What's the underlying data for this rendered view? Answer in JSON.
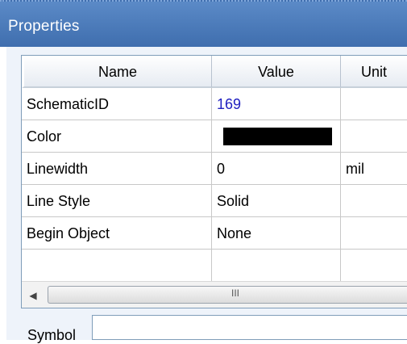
{
  "window": {
    "title": "Properties"
  },
  "grid": {
    "columns": [
      "Name",
      "Value",
      "Unit"
    ],
    "rows": [
      {
        "name": "SchematicID",
        "value": "169",
        "unit": ""
      },
      {
        "name": "Color",
        "value": "",
        "unit": "",
        "swatch": "#000000"
      },
      {
        "name": "Linewidth",
        "value": "0",
        "unit": "mil"
      },
      {
        "name": "Line Style",
        "value": "Solid",
        "unit": ""
      },
      {
        "name": "Begin Object",
        "value": "None",
        "unit": ""
      },
      {
        "name": "",
        "value": "",
        "unit": ""
      }
    ]
  },
  "scrollbar": {
    "left_arrow": "◀",
    "grip": "III"
  },
  "symbol": {
    "label": "Symbol",
    "value": ""
  },
  "colors": {
    "titlebar": "#4a7bbd",
    "id_value": "#2020c0"
  }
}
